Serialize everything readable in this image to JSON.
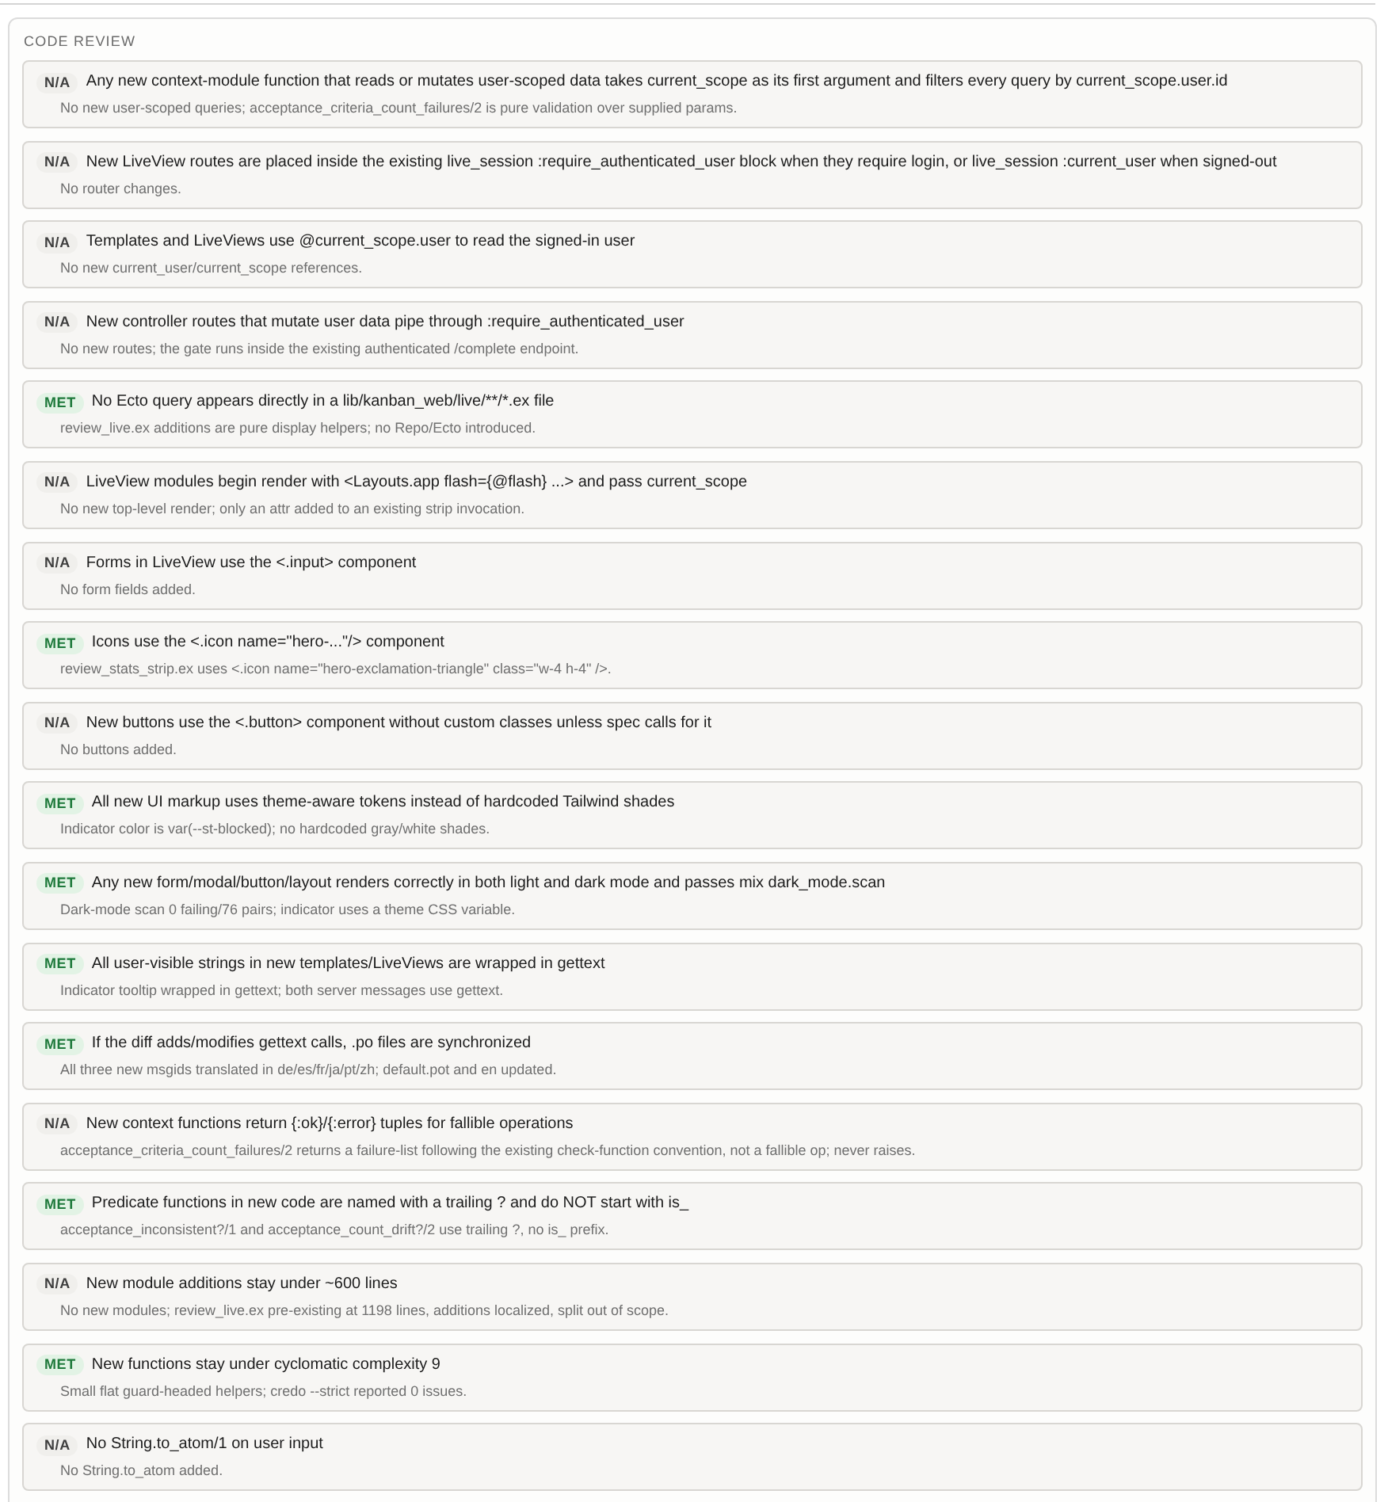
{
  "section": {
    "title": "CODE REVIEW",
    "items": [
      {
        "kind": "na",
        "status": "N/A",
        "criterion": "Any new context-module function that reads or mutates user-scoped data takes current_scope as its first argument and filters every query by current_scope.user.id",
        "note": "No new user-scoped queries; acceptance_criteria_count_failures/2 is pure validation over supplied params."
      },
      {
        "kind": "na",
        "status": "N/A",
        "criterion": "New LiveView routes are placed inside the existing live_session :require_authenticated_user block when they require login, or live_session :current_user when signed-out",
        "note": "No router changes."
      },
      {
        "kind": "na",
        "status": "N/A",
        "criterion": "Templates and LiveViews use @current_scope.user to read the signed-in user",
        "note": "No new current_user/current_scope references."
      },
      {
        "kind": "na",
        "status": "N/A",
        "criterion": "New controller routes that mutate user data pipe through :require_authenticated_user",
        "note": "No new routes; the gate runs inside the existing authenticated /complete endpoint."
      },
      {
        "kind": "met",
        "status": "MET",
        "criterion": "No Ecto query appears directly in a lib/kanban_web/live/**/*.ex file",
        "note": "review_live.ex additions are pure display helpers; no Repo/Ecto introduced."
      },
      {
        "kind": "na",
        "status": "N/A",
        "criterion": "LiveView modules begin render with <Layouts.app flash={@flash} ...> and pass current_scope",
        "note": "No new top-level render; only an attr added to an existing strip invocation."
      },
      {
        "kind": "na",
        "status": "N/A",
        "criterion": "Forms in LiveView use the <.input> component",
        "note": "No form fields added."
      },
      {
        "kind": "met",
        "status": "MET",
        "criterion": "Icons use the <.icon name=\"hero-...\"/> component",
        "note": "review_stats_strip.ex uses <.icon name=\"hero-exclamation-triangle\" class=\"w-4 h-4\" />."
      },
      {
        "kind": "na",
        "status": "N/A",
        "criterion": "New buttons use the <.button> component without custom classes unless spec calls for it",
        "note": "No buttons added."
      },
      {
        "kind": "met",
        "status": "MET",
        "criterion": "All new UI markup uses theme-aware tokens instead of hardcoded Tailwind shades",
        "note": "Indicator color is var(--st-blocked); no hardcoded gray/white shades."
      },
      {
        "kind": "met",
        "status": "MET",
        "criterion": "Any new form/modal/button/layout renders correctly in both light and dark mode and passes mix dark_mode.scan",
        "note": "Dark-mode scan 0 failing/76 pairs; indicator uses a theme CSS variable."
      },
      {
        "kind": "met",
        "status": "MET",
        "criterion": "All user-visible strings in new templates/LiveViews are wrapped in gettext",
        "note": "Indicator tooltip wrapped in gettext; both server messages use gettext."
      },
      {
        "kind": "met",
        "status": "MET",
        "criterion": "If the diff adds/modifies gettext calls, .po files are synchronized",
        "note": "All three new msgids translated in de/es/fr/ja/pt/zh; default.pot and en updated."
      },
      {
        "kind": "na",
        "status": "N/A",
        "criterion": "New context functions return {:ok}/{:error} tuples for fallible operations",
        "note": "acceptance_criteria_count_failures/2 returns a failure-list following the existing check-function convention, not a fallible op; never raises."
      },
      {
        "kind": "met",
        "status": "MET",
        "criterion": "Predicate functions in new code are named with a trailing ? and do NOT start with is_",
        "note": "acceptance_inconsistent?/1 and acceptance_count_drift?/2 use trailing ?, no is_ prefix."
      },
      {
        "kind": "na",
        "status": "N/A",
        "criterion": "New module additions stay under ~600 lines",
        "note": "No new modules; review_live.ex pre-existing at 1198 lines, additions localized, split out of scope."
      },
      {
        "kind": "met",
        "status": "MET",
        "criterion": "New functions stay under cyclomatic complexity 9",
        "note": "Small flat guard-headed helpers; credo --strict reported 0 issues."
      },
      {
        "kind": "na",
        "status": "N/A",
        "criterion": "No String.to_atom/1 on user input",
        "note": "No String.to_atom added."
      }
    ]
  }
}
